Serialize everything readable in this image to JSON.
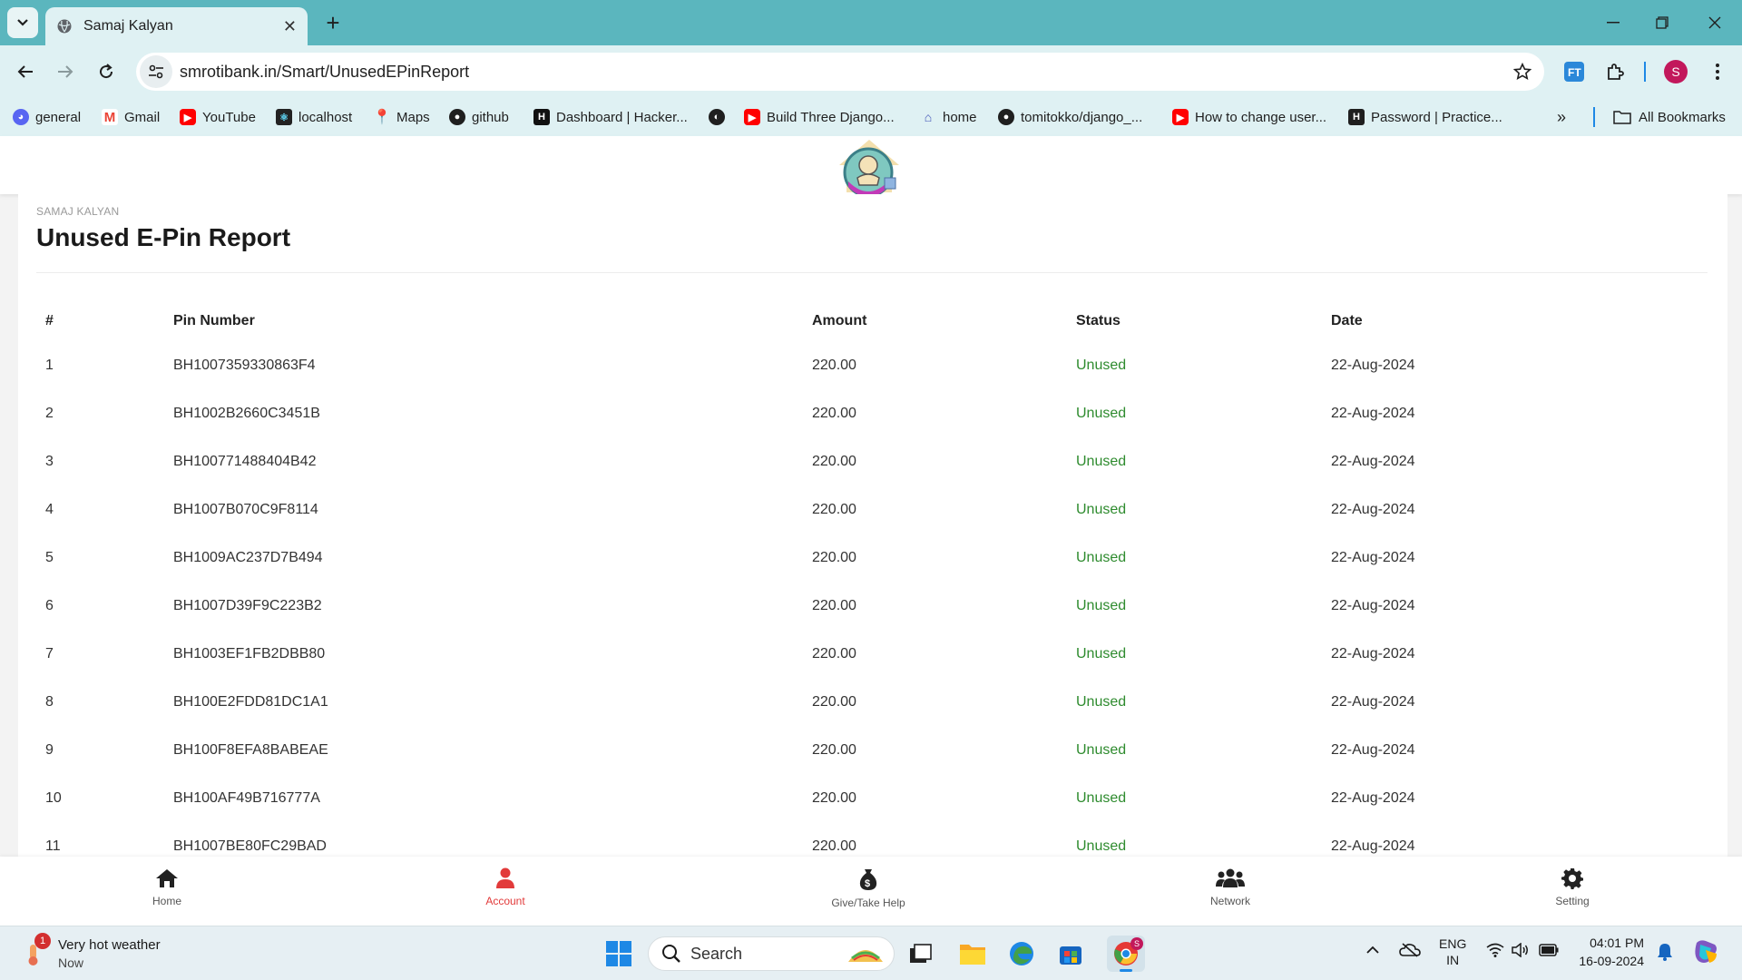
{
  "browser": {
    "tab_title": "Samaj Kalyan",
    "url": "smrotibank.in/Smart/UnusedEPinReport",
    "profile_initial": "S",
    "bookmarks": [
      {
        "label": "general",
        "icon": "discord-icon",
        "color": "#5865f2"
      },
      {
        "label": "Gmail",
        "icon": "gmail-icon",
        "color": "#ea4335"
      },
      {
        "label": "YouTube",
        "icon": "youtube-icon",
        "color": "#ff0000"
      },
      {
        "label": "localhost",
        "icon": "react-icon",
        "color": "#222222"
      },
      {
        "label": "Maps",
        "icon": "maps-icon",
        "color": "#34a853"
      },
      {
        "label": "github",
        "icon": "github-icon",
        "color": "#1f1f1f"
      },
      {
        "label": "Dashboard | Hacker...",
        "icon": "hackerrank-icon",
        "color": "#111111"
      },
      {
        "label": "",
        "icon": "globe-icon",
        "color": "#1f1f1f"
      },
      {
        "label": "Build Three Django...",
        "icon": "youtube-icon",
        "color": "#ff0000"
      },
      {
        "label": "home",
        "icon": "home-favicon",
        "color": "#3f51b5"
      },
      {
        "label": "tomitokko/django_...",
        "icon": "github-icon",
        "color": "#1f1f1f"
      },
      {
        "label": "How to change user...",
        "icon": "youtube-icon",
        "color": "#ff0000"
      },
      {
        "label": "Password | Practice...",
        "icon": "hackerrank-icon",
        "color": "#1f1f1f"
      }
    ],
    "all_bookmarks_label": "All Bookmarks"
  },
  "page": {
    "breadcrumb": "SAMAJ KALYAN",
    "title": "Unused E-Pin Report",
    "columns": [
      "#",
      "Pin Number",
      "Amount",
      "Status",
      "Date"
    ],
    "rows": [
      [
        "1",
        "BH1007359330863F4",
        "220.00",
        "Unused",
        "22-Aug-2024"
      ],
      [
        "2",
        "BH1002B2660C3451B",
        "220.00",
        "Unused",
        "22-Aug-2024"
      ],
      [
        "3",
        "BH100771488404B42",
        "220.00",
        "Unused",
        "22-Aug-2024"
      ],
      [
        "4",
        "BH1007B070C9F8114",
        "220.00",
        "Unused",
        "22-Aug-2024"
      ],
      [
        "5",
        "BH1009AC237D7B494",
        "220.00",
        "Unused",
        "22-Aug-2024"
      ],
      [
        "6",
        "BH1007D39F9C223B2",
        "220.00",
        "Unused",
        "22-Aug-2024"
      ],
      [
        "7",
        "BH1003EF1FB2DBB80",
        "220.00",
        "Unused",
        "22-Aug-2024"
      ],
      [
        "8",
        "BH100E2FDD81DC1A1",
        "220.00",
        "Unused",
        "22-Aug-2024"
      ],
      [
        "9",
        "BH100F8EFA8BABEAE",
        "220.00",
        "Unused",
        "22-Aug-2024"
      ],
      [
        "10",
        "BH100AF49B716777A",
        "220.00",
        "Unused",
        "22-Aug-2024"
      ],
      [
        "11",
        "BH1007BE80FC29BAD",
        "220.00",
        "Unused",
        "22-Aug-2024"
      ]
    ],
    "status_color": "#2e8b2e"
  },
  "bottom_nav": [
    {
      "label": "Home",
      "icon": "home-icon"
    },
    {
      "label": "Account",
      "icon": "user-icon",
      "active": true
    },
    {
      "label": "Give/Take Help",
      "icon": "money-bag-icon"
    },
    {
      "label": "Network",
      "icon": "users-icon"
    },
    {
      "label": "Setting",
      "icon": "gear-icon"
    }
  ],
  "taskbar": {
    "weather_title": "Very hot weather",
    "weather_sub": "Now",
    "weather_badge": "1",
    "search_label": "Search",
    "lang_top": "ENG",
    "lang_bottom": "IN",
    "time": "04:01 PM",
    "date": "16-09-2024"
  }
}
